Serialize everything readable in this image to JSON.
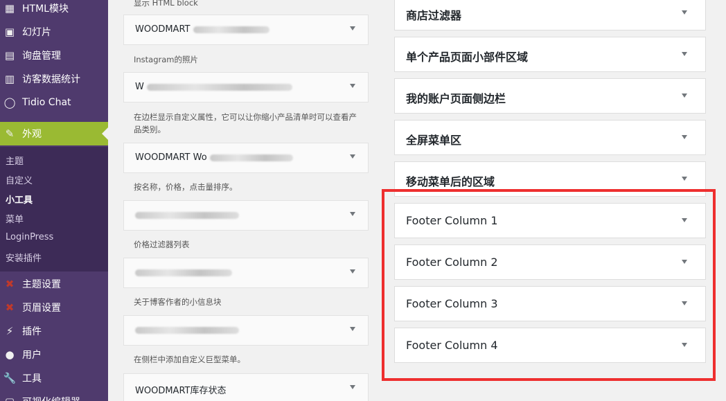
{
  "sidebar": {
    "items": [
      {
        "label": "HTML模块",
        "icon": "grid-icon"
      },
      {
        "label": "幻灯片",
        "icon": "slides-icon"
      },
      {
        "label": "询盘管理",
        "icon": "inquiry-icon"
      },
      {
        "label": "访客数据统计",
        "icon": "stats-icon"
      },
      {
        "label": "Tidio Chat",
        "icon": "chat-icon"
      },
      {
        "label": "外观",
        "icon": "brush-icon"
      },
      {
        "label": "主题设置",
        "icon": "theme-settings-icon"
      },
      {
        "label": "页眉设置",
        "icon": "header-settings-icon"
      },
      {
        "label": "插件",
        "icon": "plugin-icon"
      },
      {
        "label": "用户",
        "icon": "user-icon"
      },
      {
        "label": "工具",
        "icon": "wrench-icon"
      },
      {
        "label": "可视化编辑器",
        "icon": "editor-icon"
      }
    ],
    "submenu": [
      "主题",
      "自定义",
      "小工具",
      "菜单",
      "LoginPress",
      "安装插件"
    ],
    "current_submenu": "小工具"
  },
  "available_widgets": {
    "top_desc": "显示 HTML block",
    "items": [
      {
        "title": "WOODMART",
        "desc": "Instagram的照片"
      },
      {
        "title": "W",
        "desc": "在边栏显示自定义属性，它可以让你缩小产品清单时可以查看产品类别。"
      },
      {
        "title": "WOODMART Wo",
        "desc": "按名称，价格，点击量排序。"
      },
      {
        "title": "",
        "desc": "价格过滤器列表"
      },
      {
        "title": "",
        "desc": "关于博客作者的小信息块"
      },
      {
        "title": "",
        "desc": "在侧栏中添加自定义巨型菜单。"
      },
      {
        "title": "WOODMART库存状态",
        "desc": ""
      }
    ]
  },
  "widget_areas": [
    "商店过滤器",
    "单个产品页面小部件区域",
    "我的账户页面侧边栏",
    "全屏菜单区",
    "移动菜单后的区域",
    "Footer Column 1",
    "Footer Column 2",
    "Footer Column 3",
    "Footer Column 4"
  ],
  "colors": {
    "sidebar": "#4f3a6d",
    "active": "#9aba33",
    "highlight": "#ee2f2f"
  }
}
